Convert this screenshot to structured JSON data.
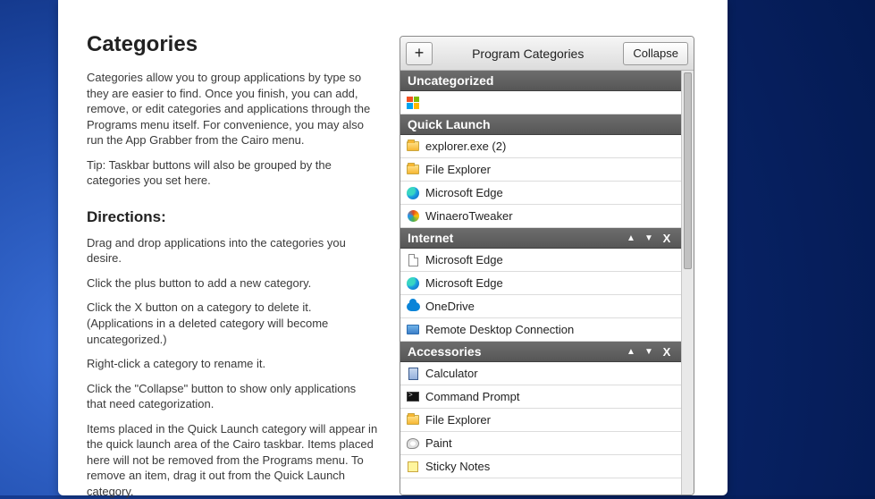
{
  "left": {
    "title": "Categories",
    "p1": "Categories allow you to group applications by type so they are easier to find. Once you finish, you can add, remove, or edit categories and applications through the Programs menu itself. For convenience, you may also run the App Grabber from the Cairo menu.",
    "p2": "Tip: Taskbar buttons will also be grouped by the categories you set here.",
    "directions_title": "Directions:",
    "d1": "Drag and drop applications into the categories you desire.",
    "d2": "Click the plus button to add a new category.",
    "d3": "Click the X button on a category to delete it. (Applications in a deleted category will become uncategorized.)",
    "d4": "Right-click a category to rename it.",
    "d5": "Click the \"Collapse\" button to show only applications that need categorization.",
    "d6": "Items placed in the Quick Launch category will appear in the quick launch area of the Cairo taskbar. Items placed here will not be removed from the Programs menu.  To remove an item, drag it out from the Quick Launch category."
  },
  "header": {
    "plus": "+",
    "title": "Program Categories",
    "collapse": "Collapse"
  },
  "categories": [
    {
      "name": "Uncategorized",
      "controls": false,
      "items": [
        {
          "icon": "win",
          "label": ""
        }
      ]
    },
    {
      "name": "Quick Launch",
      "controls": false,
      "items": [
        {
          "icon": "folder",
          "label": "explorer.exe (2)"
        },
        {
          "icon": "folder",
          "label": "File Explorer"
        },
        {
          "icon": "edge",
          "label": "Microsoft Edge"
        },
        {
          "icon": "winaero",
          "label": "WinaeroTweaker"
        }
      ]
    },
    {
      "name": "Internet",
      "controls": true,
      "items": [
        {
          "icon": "doc",
          "label": "Microsoft Edge"
        },
        {
          "icon": "edge",
          "label": "Microsoft Edge"
        },
        {
          "icon": "cloud",
          "label": "OneDrive"
        },
        {
          "icon": "rdc",
          "label": "Remote Desktop Connection"
        }
      ]
    },
    {
      "name": "Accessories",
      "controls": true,
      "items": [
        {
          "icon": "calc",
          "label": "Calculator"
        },
        {
          "icon": "cmd",
          "label": "Command Prompt"
        },
        {
          "icon": "folder",
          "label": "File Explorer"
        },
        {
          "icon": "paint",
          "label": "Paint"
        },
        {
          "icon": "sticky",
          "label": "Sticky Notes"
        }
      ]
    }
  ]
}
